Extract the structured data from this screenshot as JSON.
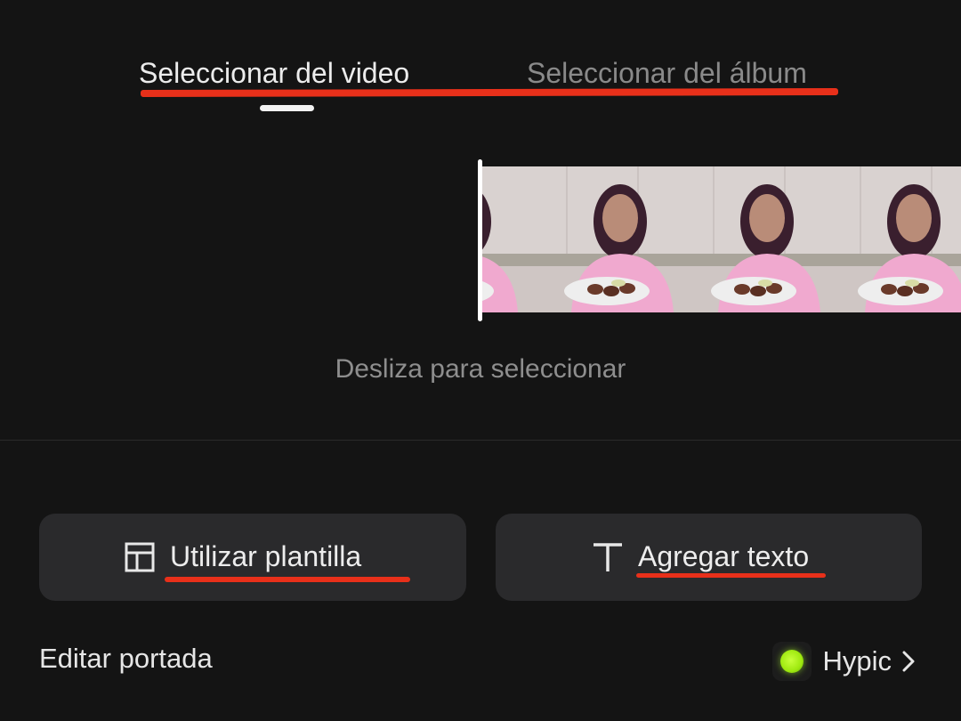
{
  "tabs": {
    "video_label": "Seleccionar del video",
    "album_label": "Seleccionar del álbum",
    "active": "video"
  },
  "filmstrip": {
    "hint": "Desliza para seleccionar",
    "frame_count": 4
  },
  "actions": {
    "template_label": "Utilizar plantilla",
    "template_icon": "template-layout-icon",
    "text_label": "Agregar texto",
    "text_icon": "text-T-icon"
  },
  "footer": {
    "cover_label": "Editar portada",
    "app_label": "Hypic",
    "app_icon": "hypic-logo-icon",
    "chevron_icon": "chevron-right-icon"
  },
  "colors": {
    "background": "#141414",
    "button": "#2a2a2c",
    "annotation_red": "#e8301a",
    "hypic_green": "#9ee80f"
  }
}
